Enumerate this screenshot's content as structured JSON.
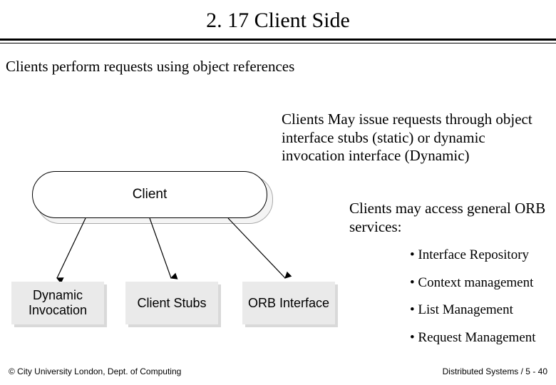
{
  "title": "2. 17 Client Side",
  "intro": "Clients perform requests using object references",
  "para1": "Clients May issue requests through object interface stubs (static) or dynamic invocation interface (Dynamic)",
  "para2": "Clients may access general ORB services:",
  "bullets": {
    "b1": "• Interface Repository",
    "b2": "• Context management",
    "b3": "• List Management",
    "b4": "• Request Management"
  },
  "diagram": {
    "client": "Client",
    "box1": "Dynamic Invocation",
    "box2": "Client Stubs",
    "box3": "ORB Interface"
  },
  "footer": {
    "left": "© City University London, Dept. of Computing",
    "right": "Distributed Systems / 5 - 40"
  }
}
